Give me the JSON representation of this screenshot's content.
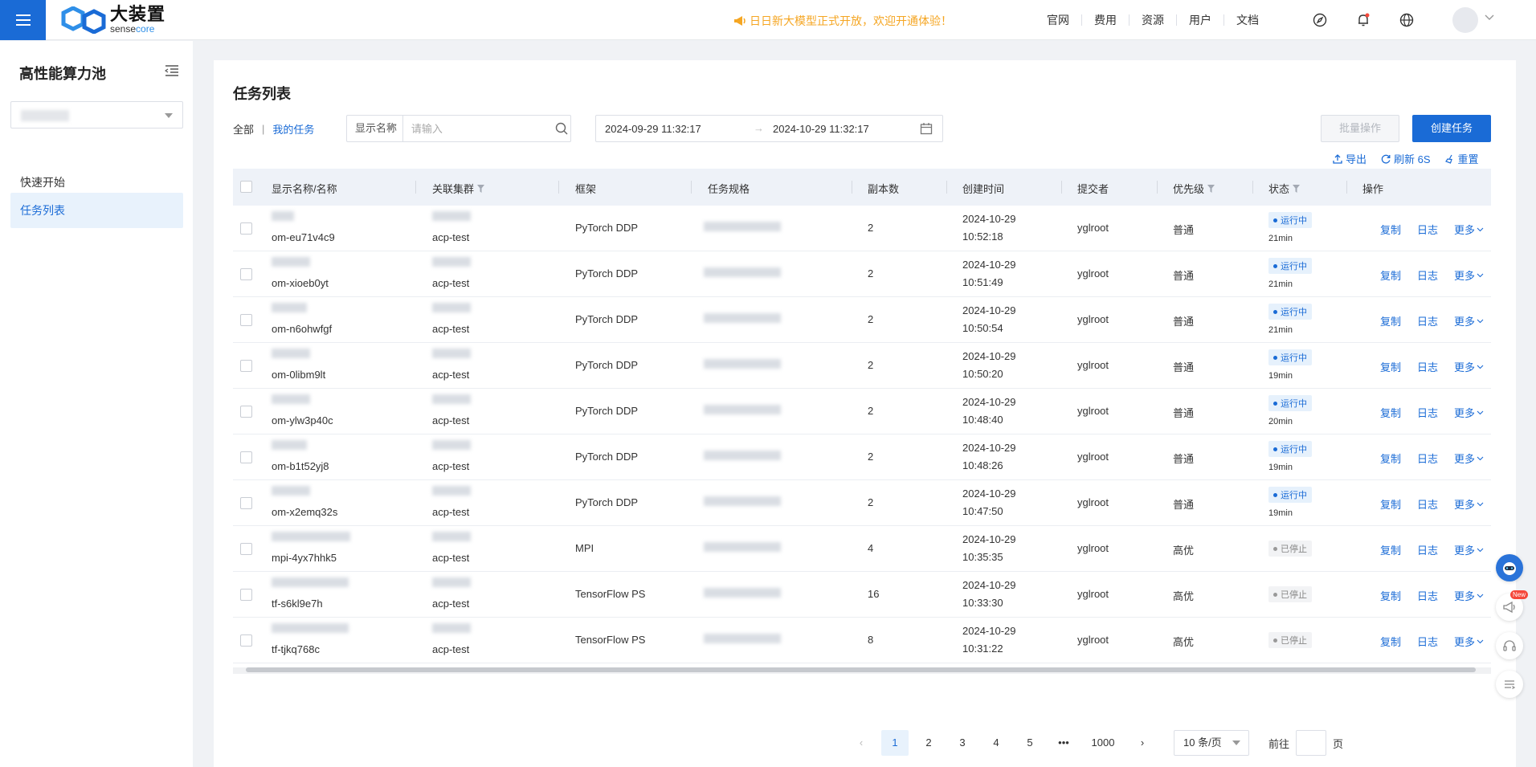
{
  "header": {
    "logo_cn": "大装置",
    "logo_en_a": "sense",
    "logo_en_b": "core",
    "announcement": "日日新大模型正式开放，欢迎开通体验！",
    "nav": [
      "官网",
      "费用",
      "资源",
      "用户",
      "文档"
    ],
    "accent": "#1a6bd6",
    "announce_color": "#f5a623"
  },
  "sidebar": {
    "title": "高性能算力池",
    "items": [
      {
        "label": "快速开始",
        "active": false
      },
      {
        "label": "任务列表",
        "active": true
      }
    ]
  },
  "main": {
    "title": "任务列表",
    "scope_all": "全部",
    "scope_sep": "|",
    "scope_mine": "我的任务",
    "filter_field": "显示名称",
    "filter_placeholder": "请输入",
    "date_start": "2024-09-29 11:32:17",
    "date_arrow": "→",
    "date_end": "2024-10-29 11:32:17",
    "batch_label": "批量操作",
    "create_label": "创建任务",
    "tools": {
      "export": "导出",
      "refresh": "刷新 6S",
      "reset": "重置"
    }
  },
  "table": {
    "columns": [
      "显示名称/名称",
      "关联集群",
      "框架",
      "任务规格",
      "副本数",
      "创建时间",
      "提交者",
      "优先级",
      "状态",
      "操作"
    ],
    "rows": [
      {
        "name": "om-eu71v4c9",
        "cluster": "acp-test",
        "framework": "PyTorch DDP",
        "replicas": "2",
        "date": "2024-10-29",
        "time": "10:52:18",
        "submitter": "yglroot",
        "priority": "普通",
        "status": "运行中",
        "status_type": "run",
        "duration": "21min"
      },
      {
        "name": "om-xioeb0yt",
        "cluster": "acp-test",
        "framework": "PyTorch DDP",
        "replicas": "2",
        "date": "2024-10-29",
        "time": "10:51:49",
        "submitter": "yglroot",
        "priority": "普通",
        "status": "运行中",
        "status_type": "run",
        "duration": "21min"
      },
      {
        "name": "om-n6ohwfgf",
        "cluster": "acp-test",
        "framework": "PyTorch DDP",
        "replicas": "2",
        "date": "2024-10-29",
        "time": "10:50:54",
        "submitter": "yglroot",
        "priority": "普通",
        "status": "运行中",
        "status_type": "run",
        "duration": "21min"
      },
      {
        "name": "om-0libm9lt",
        "cluster": "acp-test",
        "framework": "PyTorch DDP",
        "replicas": "2",
        "date": "2024-10-29",
        "time": "10:50:20",
        "submitter": "yglroot",
        "priority": "普通",
        "status": "运行中",
        "status_type": "run",
        "duration": "19min"
      },
      {
        "name": "om-ylw3p40c",
        "cluster": "acp-test",
        "framework": "PyTorch DDP",
        "replicas": "2",
        "date": "2024-10-29",
        "time": "10:48:40",
        "submitter": "yglroot",
        "priority": "普通",
        "status": "运行中",
        "status_type": "run",
        "duration": "20min"
      },
      {
        "name": "om-b1t52yj8",
        "cluster": "acp-test",
        "framework": "PyTorch DDP",
        "replicas": "2",
        "date": "2024-10-29",
        "time": "10:48:26",
        "submitter": "yglroot",
        "priority": "普通",
        "status": "运行中",
        "status_type": "run",
        "duration": "19min"
      },
      {
        "name": "om-x2emq32s",
        "cluster": "acp-test",
        "framework": "PyTorch DDP",
        "replicas": "2",
        "date": "2024-10-29",
        "time": "10:47:50",
        "submitter": "yglroot",
        "priority": "普通",
        "status": "运行中",
        "status_type": "run",
        "duration": "19min"
      },
      {
        "name": "mpi-4yx7hhk5",
        "cluster": "acp-test",
        "framework": "MPI",
        "replicas": "4",
        "date": "2024-10-29",
        "time": "10:35:35",
        "submitter": "yglroot",
        "priority": "高优",
        "status": "已停止",
        "status_type": "stop",
        "duration": ""
      },
      {
        "name": "tf-s6kl9e7h",
        "cluster": "acp-test",
        "framework": "TensorFlow PS",
        "replicas": "16",
        "date": "2024-10-29",
        "time": "10:33:30",
        "submitter": "yglroot",
        "priority": "高优",
        "status": "已停止",
        "status_type": "stop",
        "duration": ""
      },
      {
        "name": "tf-tjkq768c",
        "cluster": "acp-test",
        "framework": "TensorFlow PS",
        "replicas": "8",
        "date": "2024-10-29",
        "time": "10:31:22",
        "submitter": "yglroot",
        "priority": "高优",
        "status": "已停止",
        "status_type": "stop",
        "duration": ""
      }
    ],
    "actions": {
      "copy": "复制",
      "log": "日志",
      "more": "更多"
    }
  },
  "pagination": {
    "pages": [
      "1",
      "2",
      "3",
      "4",
      "5"
    ],
    "ellipsis": "•••",
    "last": "1000",
    "current": "1",
    "page_size": "10 条/页",
    "goto_prefix": "前往",
    "goto_suffix": "页"
  },
  "floating": {
    "new_tag": "New"
  }
}
